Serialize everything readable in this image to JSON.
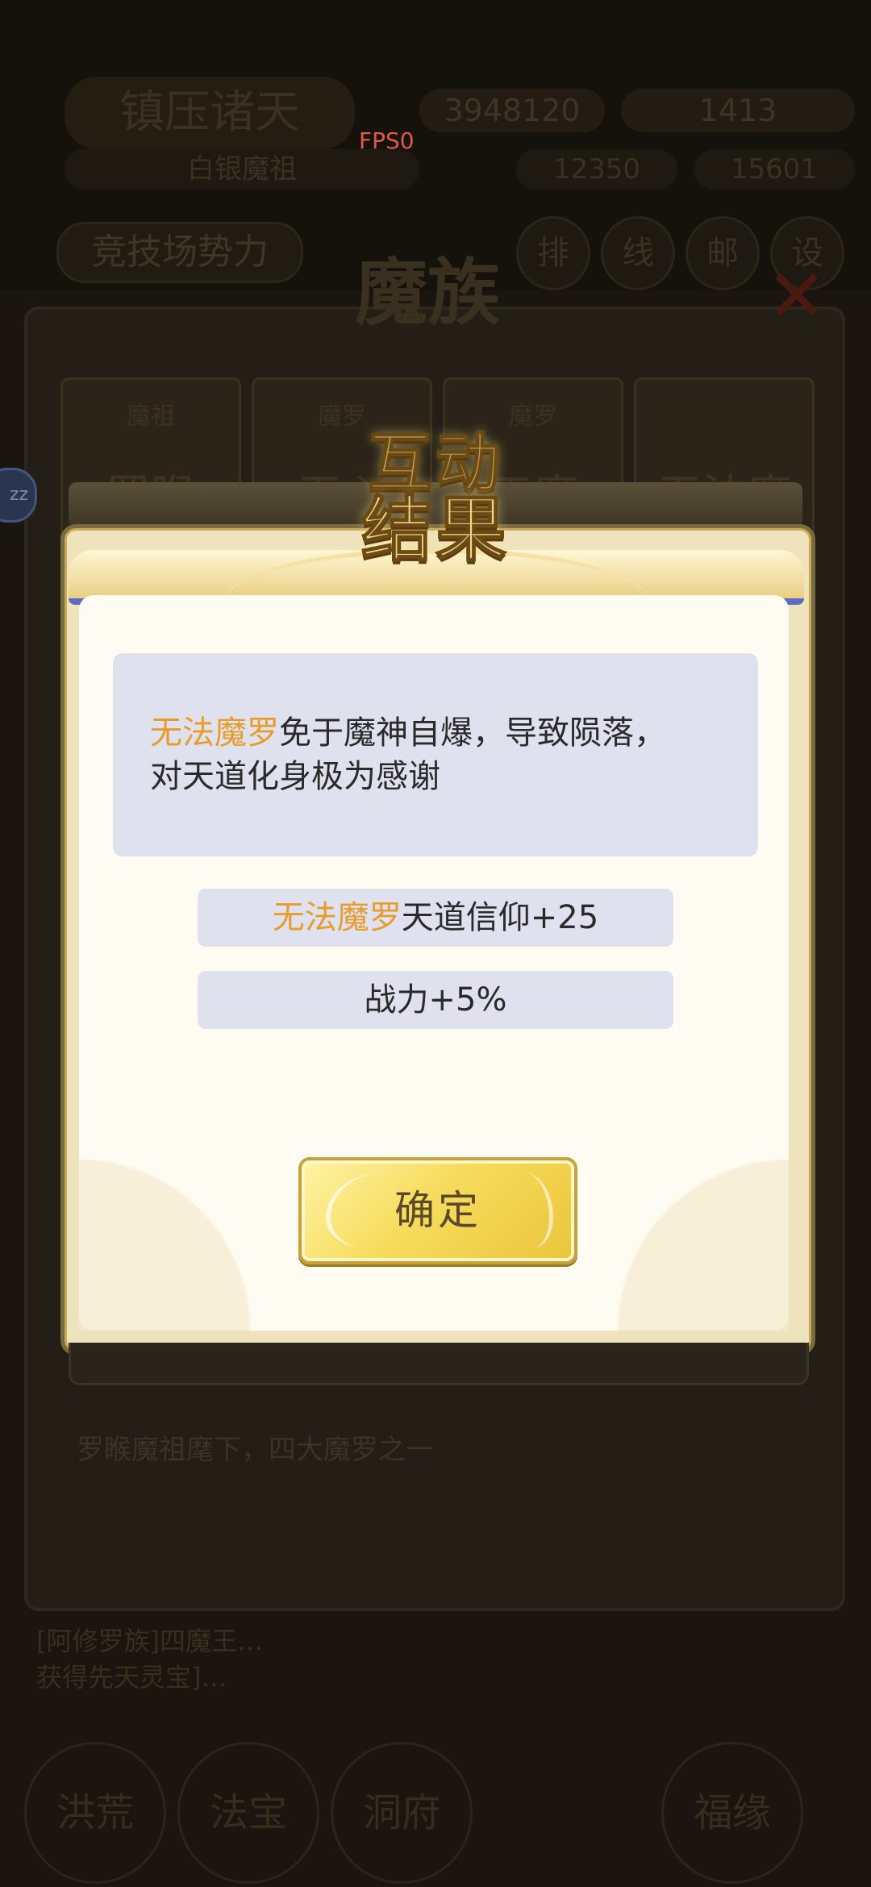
{
  "overlay": {
    "fps_label": "FPS0"
  },
  "background": {
    "top_title": "镇压诸天",
    "stat_1": "3948120",
    "stat_2": "1413",
    "row2_left": "白银魔祖",
    "row2_mid": "12350",
    "row2_right": "15601",
    "arena_button": "竞技场势力",
    "round_buttons": [
      "排",
      "线",
      "邮",
      "设"
    ],
    "panel_title": "魔族",
    "cards": [
      {
        "tag": "魔祖",
        "name": "罗睺"
      },
      {
        "tag": "魔罗",
        "name": "无心"
      },
      {
        "tag": "魔罗",
        "name": "天魔"
      },
      {
        "tag": "",
        "name": "无法魔"
      }
    ],
    "side_bubble": "zz",
    "description": "罗睺魔祖麾下，四大魔罗之一",
    "log_line_1": "[阿修罗族]四魔王…",
    "log_line_2": "获得先天灵宝]…",
    "bottom_buttons": [
      "洪荒",
      "法宝",
      "洞府",
      "福缘"
    ]
  },
  "dialog": {
    "title_line_1": "互动",
    "title_line_2": "结果",
    "message": {
      "highlight_name": "无法魔罗",
      "text_line_1": "免于魔神自爆，导致陨落，",
      "text_line_2": "对天道化身极为感谢"
    },
    "rewards": [
      {
        "highlight": "无法魔罗",
        "text": "天道信仰+25"
      },
      {
        "highlight": "",
        "text": "战力+5%"
      }
    ],
    "confirm_label": "确定"
  },
  "colors": {
    "highlight": "#e79c2c",
    "reward_bg": "#dfe2ee",
    "confirm_gold": "#f6dc5c",
    "book_edge_blue": "#5f6bc0"
  }
}
